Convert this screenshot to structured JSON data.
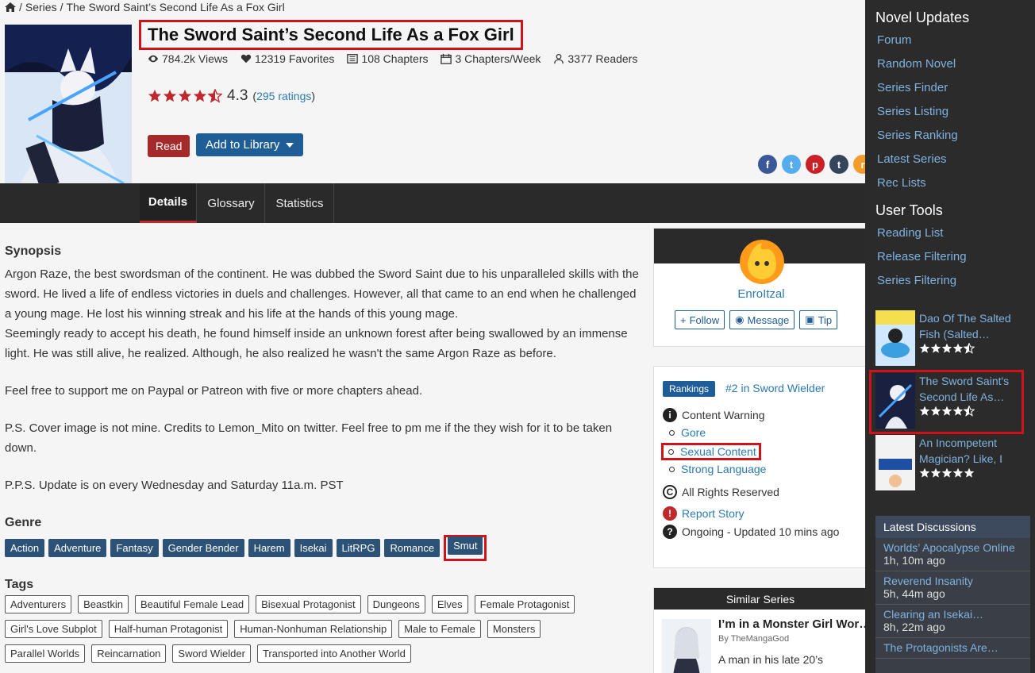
{
  "breadcrumb": {
    "separator1": "/",
    "series": "Series",
    "separator2": "/",
    "current": "The Sword Saint’s Second Life As a Fox Girl"
  },
  "novel": {
    "title": "The Sword Saint’s Second Life As a Fox Girl",
    "stats": {
      "views": "784.2k Views",
      "favorites": "12319 Favorites",
      "chapters": "108 Chapters",
      "rate": "3 Chapters/Week",
      "readers": "3377 Readers"
    },
    "rating": {
      "value": "4.3",
      "stars": 4.5,
      "count_open": "(",
      "count_link": "295 ratings",
      "count_close": ")"
    },
    "read_label": "Read",
    "library_label": "Add to Library"
  },
  "share_icons": [
    "facebook-icon",
    "twitter-icon",
    "pinterest-icon",
    "tumblr-icon",
    "rss-icon"
  ],
  "tabs": [
    "Details",
    "Glossary",
    "Statistics"
  ],
  "synopsis": {
    "heading": "Synopsis",
    "p1a": "Argon Raze, the best swordsman of the continent. He was dubbed the Sword Saint due to his unparalleled skills with the sword. He lived a life of endless victories in duels and challenges. However, all that came to an end when he challenged a young mage. He lost his winning streak and his life at the hands of this young mage.",
    "p1b": "Seemingly ready to accept his death, he found himself inside an unknown forest after being swallowed by an immense light. He was still alive, he realized. Although, he also realized he wasn't the same Argon Raze as before.",
    "p2": "Feel free to support me on Paypal or Patreon with five or more chapters ahead.",
    "p3": "P.S. Cover image is not mine. Credits to Lemon_Mito on twitter. Feel free to pm me if the they wish for it to be taken down.",
    "p4": "P.P.S. Update is on every Wednesday and Saturday 11a.m. PST"
  },
  "genre": {
    "heading": "Genre",
    "items": [
      "Action",
      "Adventure",
      "Fantasy",
      "Gender Bender",
      "Harem",
      "Isekai",
      "LitRPG",
      "Romance",
      "Smut"
    ]
  },
  "tags": {
    "heading": "Tags",
    "row1": [
      "Adventurers",
      "Beastkin",
      "Beautiful Female Lead",
      "Bisexual Protagonist",
      "Dungeons",
      "Elves",
      "Female Protagonist"
    ],
    "row2": [
      "Girl's Love Subplot",
      "Half-human Protagonist",
      "Human-Nonhuman Relationship",
      "Male to Female",
      "Monsters"
    ],
    "row3": [
      "Parallel Worlds",
      "Reincarnation",
      "Sword Wielder",
      "Transported into Another World"
    ]
  },
  "author": {
    "name": "EnroItzal",
    "follow": "Follow",
    "message": "Message",
    "tip": "Tip"
  },
  "info": {
    "rankings_label": "Rankings",
    "rank_text": "#2 in Sword Wielder",
    "content_warning": "Content Warning",
    "warnings": [
      "Gore",
      "Sexual Content",
      "Strong Language"
    ],
    "copyright": "All Rights Reserved",
    "report": "Report Story",
    "status": "Ongoing - Updated 10 mins ago"
  },
  "similar": {
    "heading": "Similar Series",
    "title": "I’m in a Monster Girl Wor…",
    "by": "By TheMangaGod",
    "desc": "A man in his late 20’s"
  },
  "sidebar": {
    "heading1": "Novel Updates",
    "links1": [
      "Forum",
      "Random Novel",
      "Series Finder",
      "Series Listing",
      "Series Ranking",
      "Latest Series",
      "Rec Lists"
    ],
    "heading2": "User Tools",
    "links2": [
      "Reading List",
      "Release Filtering",
      "Series Filtering"
    ],
    "novels": [
      {
        "title": "Dao Of The Salted Fish (Salted…",
        "stars": 4.5
      },
      {
        "title": "The Sword Saint's Second Life As…",
        "stars": 4.5
      },
      {
        "title": "An Incompetent Magician? Like, I",
        "stars": 5
      }
    ],
    "discussions_heading": "Latest Discussions",
    "discussions": [
      {
        "title": "Worlds’ Apocalypse Online",
        "ago": "1h, 10m ago"
      },
      {
        "title": "Reverend Insanity",
        "ago": "5h, 44m ago"
      },
      {
        "title": "Clearing an Isekai…",
        "ago": "8h, 22m ago"
      },
      {
        "title": "The Protagonists Are…",
        "ago": ""
      }
    ]
  },
  "colors": {
    "accent_red": "#d0121b",
    "link": "#2a7ab0",
    "primary_blue": "#1f5d96",
    "genre_bg": "#2c5277",
    "read_red": "#a52a2a"
  }
}
